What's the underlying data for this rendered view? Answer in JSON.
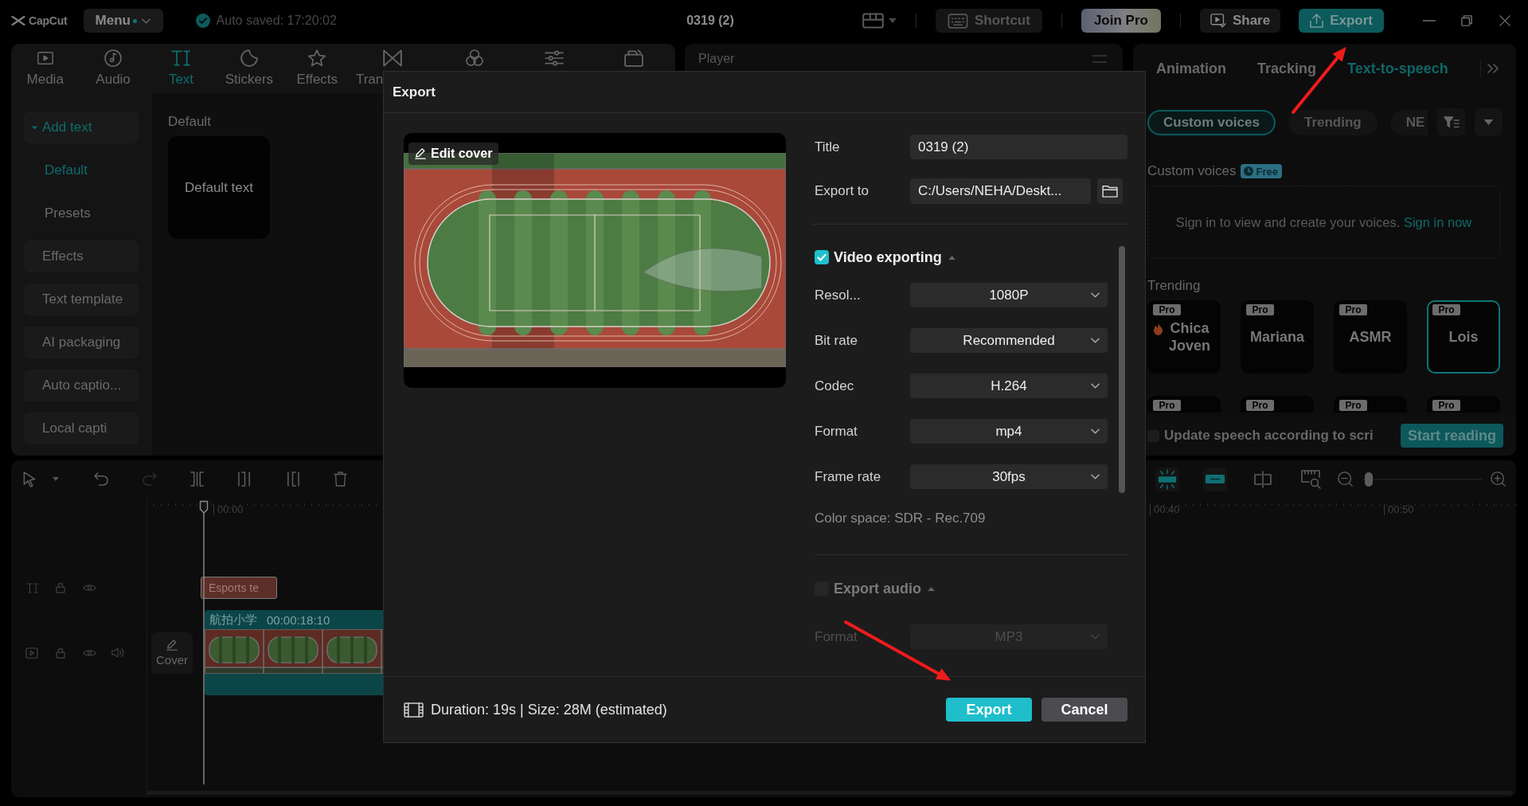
{
  "titlebar": {
    "app_name": "CapCut",
    "menu": "Menu",
    "autosave": "Auto saved: 17:20:02",
    "project_title": "0319 (2)",
    "actions": [
      {
        "kind": "shortcut",
        "label": "Shortcut"
      },
      {
        "kind": "pro",
        "label": "Join Pro"
      },
      {
        "kind": "share",
        "label": "Share"
      },
      {
        "kind": "export",
        "label": "Export"
      }
    ]
  },
  "media_tabs": [
    {
      "label": "Media",
      "selected": false
    },
    {
      "label": "Audio",
      "selected": false
    },
    {
      "label": "Text",
      "selected": true
    },
    {
      "label": "Stickers",
      "selected": false
    },
    {
      "label": "Effects",
      "selected": false
    },
    {
      "label": "Tran",
      "selected": false
    },
    {
      "selected": false
    },
    {
      "selected": false
    },
    {
      "selected": false
    }
  ],
  "sidebar": {
    "items": [
      {
        "kind": "group",
        "label": "Add text",
        "selected": true,
        "expanded": true
      },
      {
        "kind": "sub",
        "label": "Default",
        "selected": true
      },
      {
        "kind": "sub",
        "label": "Presets",
        "selected": false
      },
      {
        "kind": "item",
        "label": "Effects",
        "selected": false
      },
      {
        "kind": "item",
        "label": "Text template",
        "selected": false
      },
      {
        "kind": "item",
        "label": "AI packaging",
        "selected": false
      },
      {
        "kind": "item",
        "label": "Auto captio...",
        "selected": false
      },
      {
        "kind": "item",
        "label": "Local capti",
        "selected": false
      }
    ]
  },
  "library": {
    "heading": "Default",
    "cards": [
      {
        "label": "Default text"
      }
    ]
  },
  "player": {
    "title": "Player"
  },
  "inspector": {
    "tabs": [
      {
        "label": "Animation",
        "selected": false
      },
      {
        "label": "Tracking",
        "selected": false
      },
      {
        "label": "Text-to-speech",
        "selected": true
      }
    ],
    "chips": [
      {
        "label": "Custom voices",
        "selected": true
      },
      {
        "label": "Trending",
        "selected": false
      },
      {
        "label": "NE",
        "selected": false
      }
    ],
    "custom_voices": {
      "heading": "Custom voices",
      "badge": "Free",
      "message": "Sign in to view and create your voices.",
      "link": "Sign in now"
    },
    "trending": {
      "heading": "Trending",
      "voices": [
        {
          "name": "Chica Joven",
          "badge": "Pro",
          "hot": true,
          "selected": false
        },
        {
          "name": "Mariana",
          "badge": "Pro",
          "selected": false
        },
        {
          "name": "ASMR",
          "badge": "Pro",
          "selected": false
        },
        {
          "name": "Lois",
          "badge": "Pro",
          "selected": true
        },
        {
          "badge": "Pro",
          "selected": false
        },
        {
          "badge": "Pro",
          "selected": false
        },
        {
          "badge": "Pro",
          "selected": false
        },
        {
          "badge": "Pro",
          "selected": false
        }
      ]
    },
    "update_speech": {
      "label": "Update speech according to scri",
      "checked": false
    },
    "start_button": "Start reading"
  },
  "timeline": {
    "tools": [
      {
        "kind": "select"
      },
      {
        "kind": "undo",
        "disabled": false
      },
      {
        "kind": "redo",
        "disabled": true
      },
      {
        "kind": "split"
      },
      {
        "kind": "trim_left"
      },
      {
        "kind": "trim_right"
      },
      {
        "kind": "delete"
      }
    ],
    "right_tools": [
      {
        "kind": "snap",
        "on": true
      },
      {
        "kind": "link",
        "on": true
      },
      {
        "kind": "split_preview"
      },
      {
        "kind": "preview"
      }
    ],
    "zoom": {
      "level": 0.02
    },
    "ruler": [
      "00:00",
      "00:40",
      "00:50"
    ],
    "tracks": [
      {
        "kind": "text",
        "clips": [
          {
            "label": "Esports te"
          }
        ]
      },
      {
        "kind": "video",
        "cover": "Cover",
        "clips": [
          {
            "label": "航拍小学",
            "duration": "00:00:18:10"
          }
        ]
      }
    ]
  },
  "export_dialog": {
    "title": "Export",
    "cover_button": "Edit cover",
    "fields": [
      {
        "kind": "text",
        "label": "Title",
        "value": "0319 (2)"
      },
      {
        "kind": "folder",
        "label": "Export to",
        "value": "C:/Users/NEHA/Deskt..."
      }
    ],
    "sections": [
      {
        "title": "Video exporting",
        "checked": true,
        "expanded": true,
        "settings": [
          {
            "label": "Resol...",
            "value": "1080P"
          },
          {
            "label": "Bit rate",
            "value": "Recommended"
          },
          {
            "label": "Codec",
            "value": "H.264"
          },
          {
            "label": "Format",
            "value": "mp4"
          },
          {
            "label": "Frame rate",
            "value": "30fps"
          }
        ],
        "note": "Color space: SDR - Rec.709"
      },
      {
        "title": "Export audio",
        "checked": false,
        "expanded": true,
        "settings": [
          {
            "label": "Format",
            "value": "MP3"
          }
        ]
      }
    ],
    "summary": "Duration: 19s | Size: 28M (estimated)",
    "buttons": [
      {
        "kind": "primary",
        "label": "Export"
      },
      {
        "kind": "secondary",
        "label": "Cancel"
      }
    ]
  },
  "annotations": [
    {
      "kind": "arrow"
    },
    {
      "kind": "arrow"
    }
  ]
}
